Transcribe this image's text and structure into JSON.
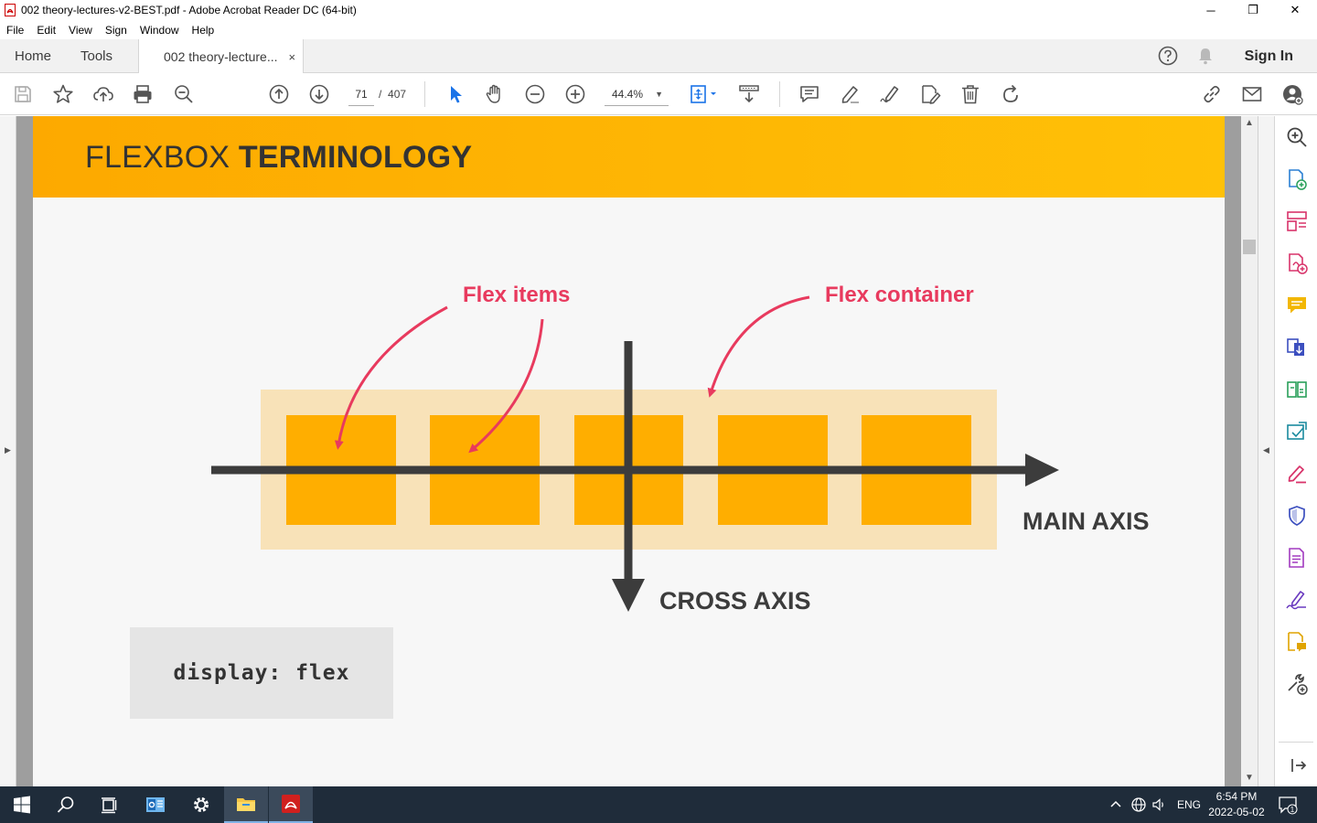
{
  "window": {
    "title": "002 theory-lectures-v2-BEST.pdf - Adobe Acrobat Reader DC (64-bit)",
    "minimize": "─",
    "restore": "❐",
    "close": "✕"
  },
  "menu": [
    "File",
    "Edit",
    "View",
    "Sign",
    "Window",
    "Help"
  ],
  "tabs": {
    "home": "Home",
    "tools": "Tools",
    "document": "002 theory-lecture...",
    "close": "×",
    "sign_in": "Sign In"
  },
  "toolbar": {
    "page_current": "71",
    "page_separator": "/",
    "page_total": "407",
    "zoom": "44.4%"
  },
  "slide": {
    "title_light": "FLEXBOX ",
    "title_bold": "TERMINOLOGY",
    "label_flex_items": "Flex items",
    "label_flex_container": "Flex container",
    "label_main_axis": "MAIN AXIS",
    "label_cross_axis": "CROSS AXIS",
    "code": "display: flex",
    "colors": {
      "banner": "#fda900",
      "container": "#f8e2b8",
      "item": "#ffae00",
      "axis": "#3c3c3c",
      "annotation": "#e83a5e"
    }
  },
  "taskbar": {
    "language": "ENG",
    "time": "6:54 PM",
    "date": "2022-05-02",
    "notifications": "1"
  }
}
